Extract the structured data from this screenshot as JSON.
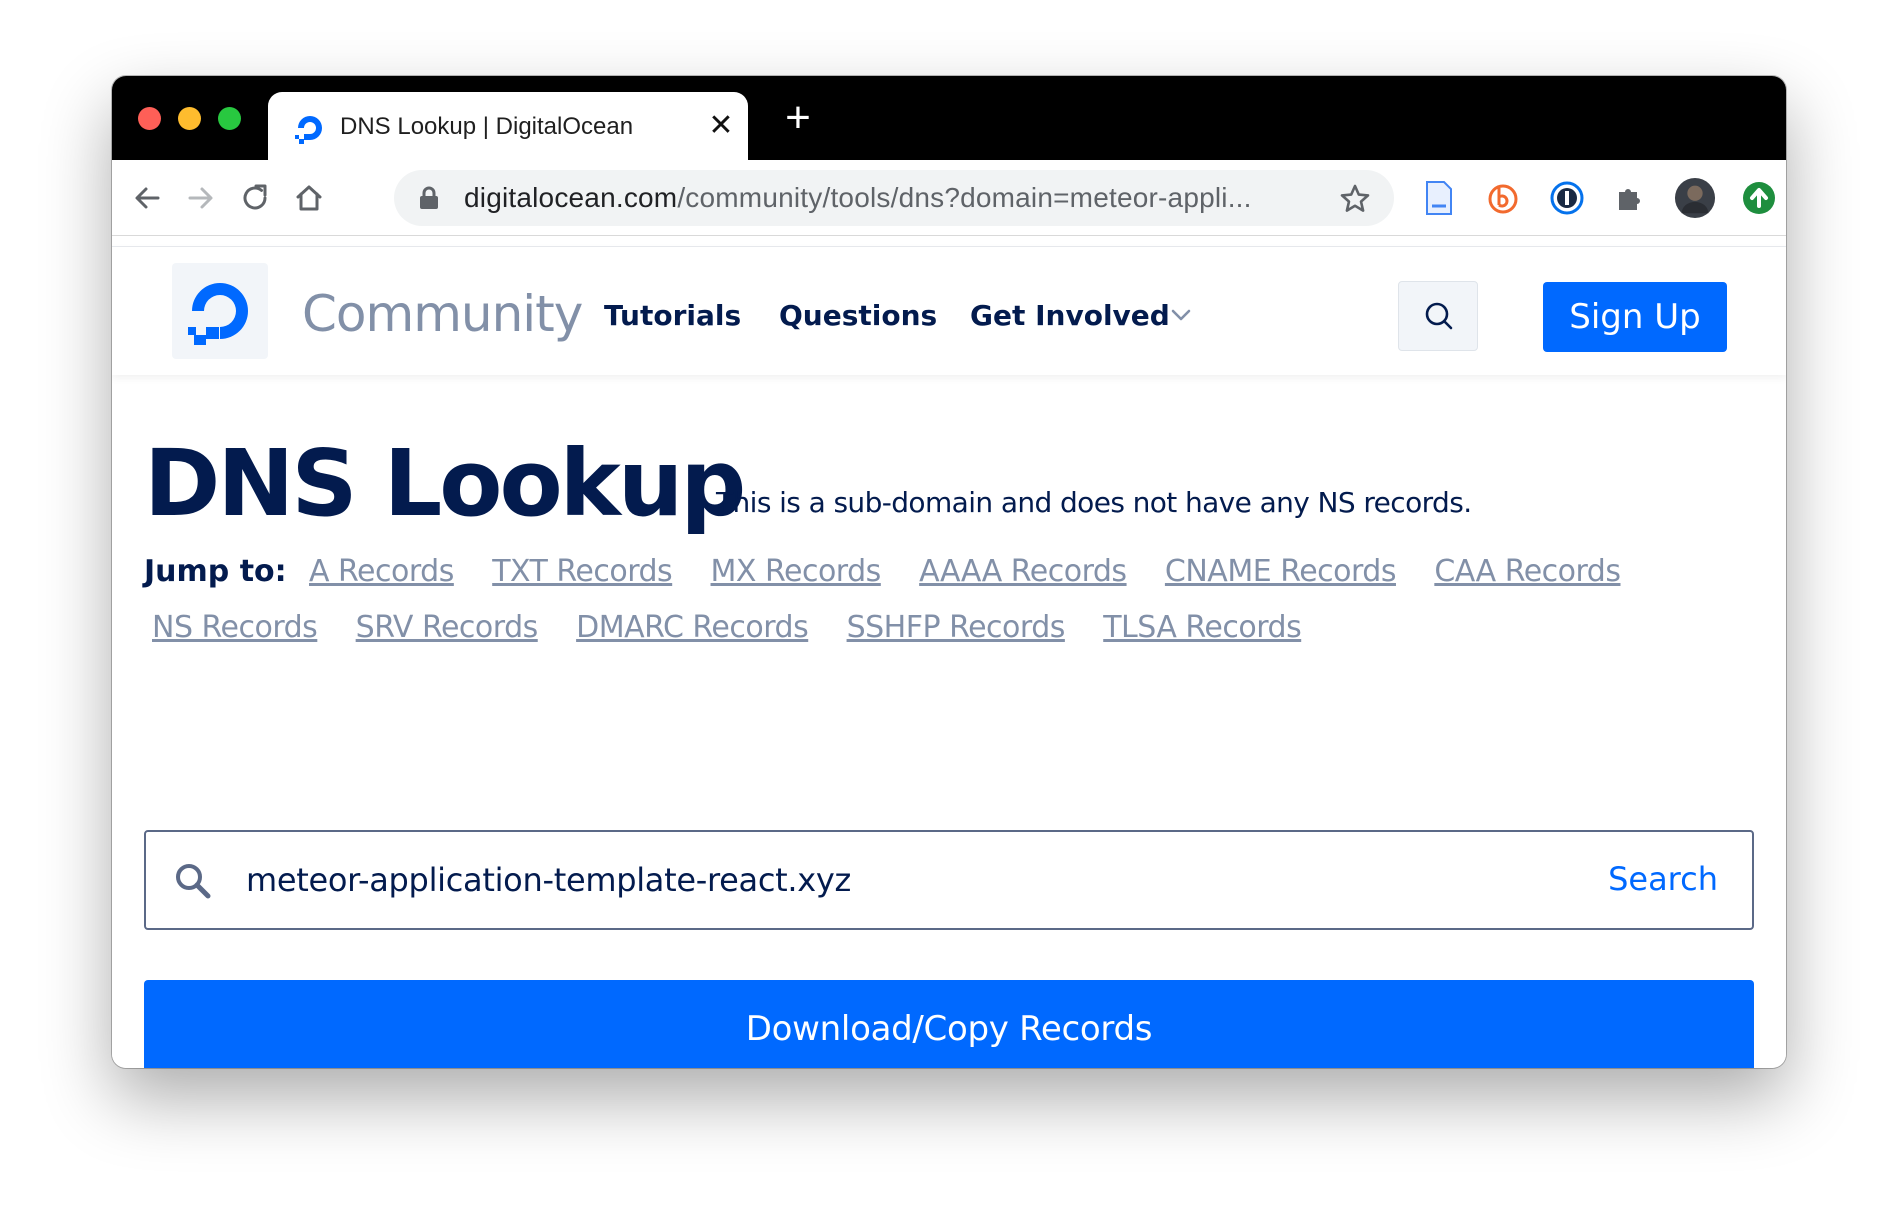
{
  "browser": {
    "tab_title": "DNS Lookup | DigitalOcean",
    "tab_close": "✕",
    "new_tab": "+",
    "url_host": "digitalocean.com",
    "url_path": "/community/tools/dns?domain=meteor-appli...",
    "icons": [
      "back-icon",
      "forward-icon",
      "reload-icon",
      "home-icon",
      "lock-icon",
      "star-icon",
      "document-extension-icon",
      "b-extension-icon",
      "password-manager-icon",
      "puzzle-extension-icon",
      "profile-avatar",
      "update-arrow-icon"
    ]
  },
  "nav": {
    "brand": "Community",
    "links": [
      "Tutorials",
      "Questions",
      "Get Involved"
    ],
    "signup": "Sign Up"
  },
  "main": {
    "title": "DNS Lookup",
    "note": "This is a sub-domain and does not have any NS records.",
    "jump_label": "Jump to:",
    "jump_links_row1": [
      "A Records",
      "TXT Records",
      "MX Records",
      "AAAA Records",
      "CNAME Records",
      "CAA Records"
    ],
    "jump_links_row2": [
      "NS Records",
      "SRV Records",
      "DMARC Records",
      "SSHFP Records",
      "TLSA Records"
    ],
    "search_value": "meteor-application-template-react.xyz",
    "search_button": "Search",
    "download_button": "Download/Copy Records"
  },
  "colors": {
    "brand_blue": "#0069ff",
    "navy": "#031b4e",
    "muted": "#8290a8"
  }
}
